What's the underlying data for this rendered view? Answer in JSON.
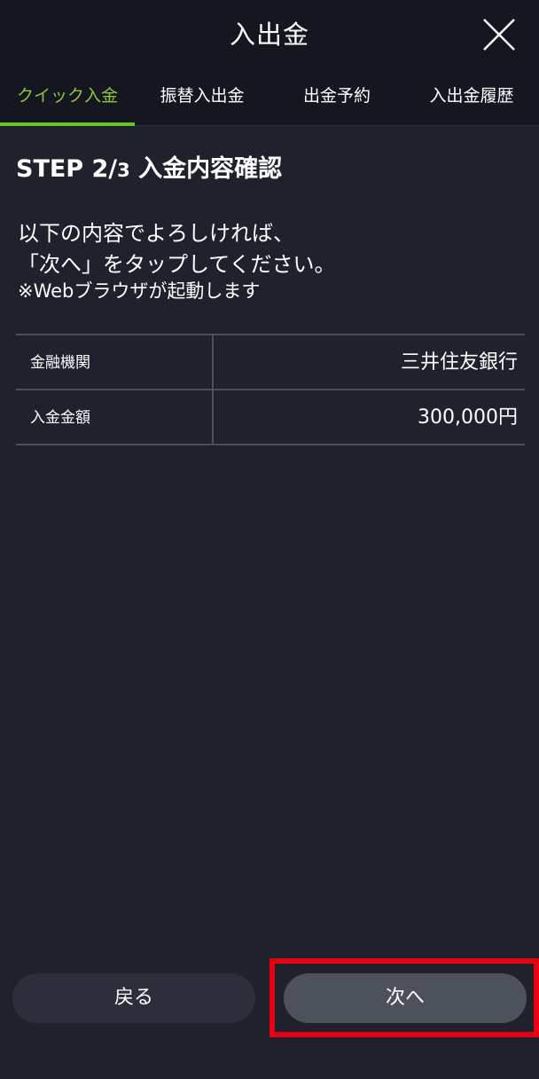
{
  "header": {
    "title": "入出金",
    "close_icon": "close-icon"
  },
  "tabs": [
    {
      "label": "クイック入金",
      "active": true
    },
    {
      "label": "振替入出金",
      "active": false
    },
    {
      "label": "出金予約",
      "active": false
    },
    {
      "label": "入出金履歴",
      "active": false
    }
  ],
  "step": {
    "prefix": "STEP 2/",
    "total": "3",
    "title": " 入金内容確認"
  },
  "message": {
    "line1": "以下の内容でよろしければ、",
    "line2": "「次へ」をタップしてください。",
    "note": "※Webブラウザが起動します"
  },
  "details": [
    {
      "label": "金融機関",
      "value": "三井住友銀行"
    },
    {
      "label": "入金金額",
      "value": "300,000円"
    }
  ],
  "buttons": {
    "back": "戻る",
    "next": "次へ"
  },
  "colors": {
    "background": "#1f222d",
    "header": "#151720",
    "accent_green": "#62c52a",
    "highlight_red": "#e60012"
  }
}
